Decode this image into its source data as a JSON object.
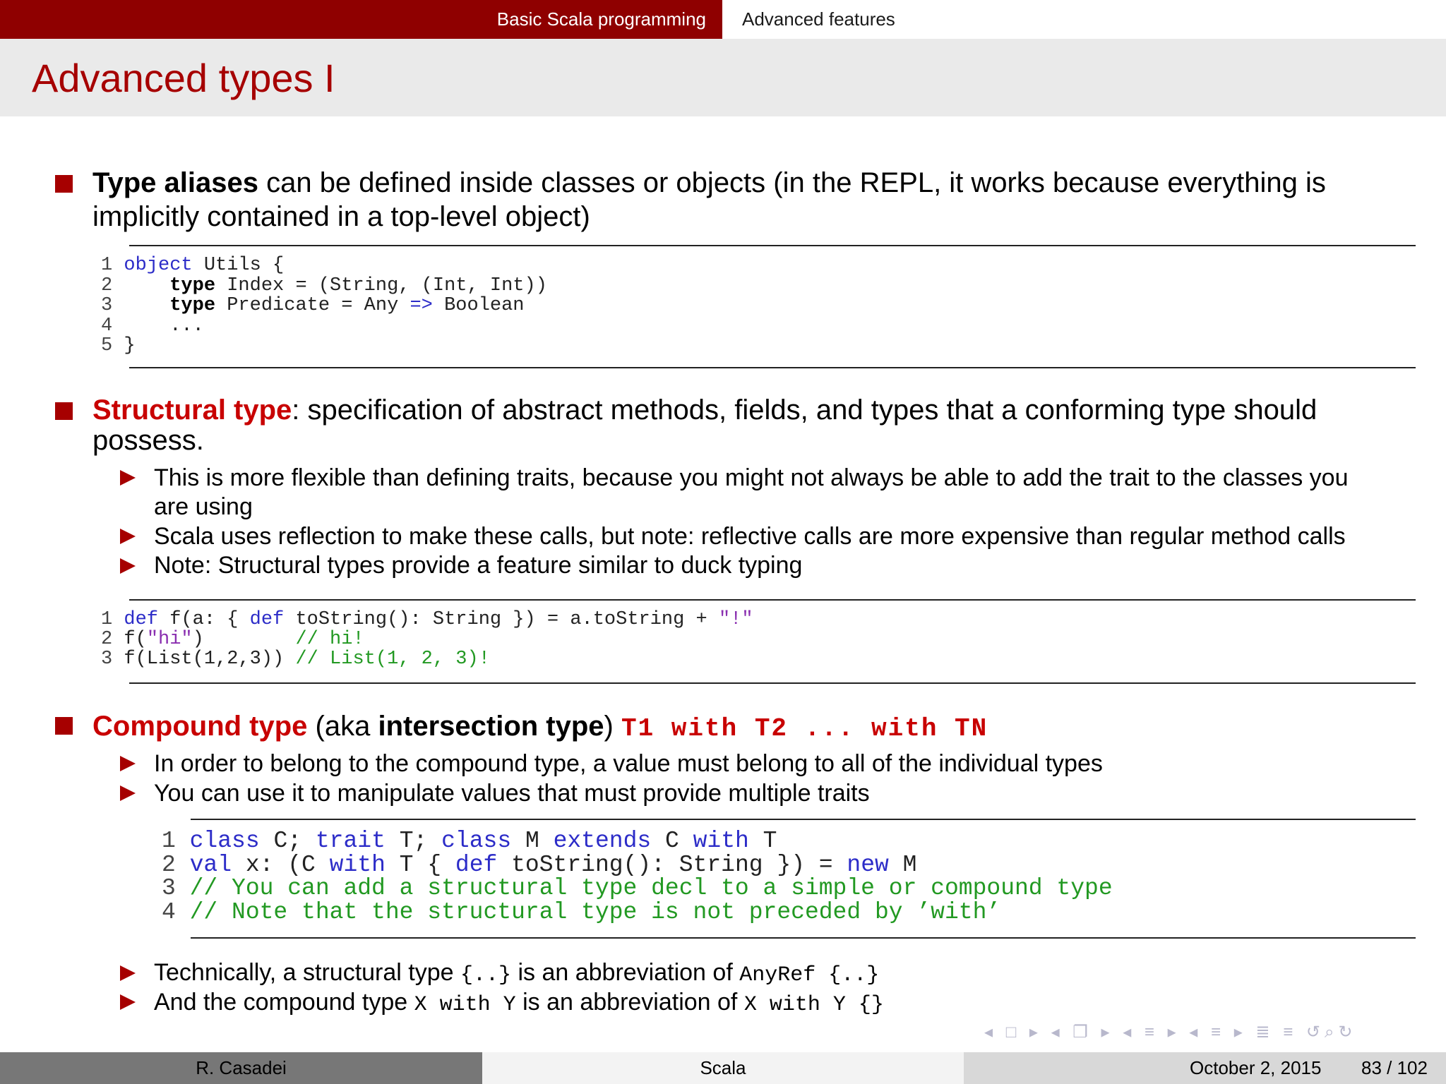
{
  "nav": {
    "section_basic": "Basic Scala programming",
    "section_advanced": "Advanced features"
  },
  "frame": {
    "title": "Advanced types I"
  },
  "type_aliases": {
    "term": "Type aliases",
    "line1": " can be defined inside classes or objects (in the REPL, it works because everything is",
    "line2": "implicitly contained in a top-level object)",
    "code": [
      {
        "n": "1",
        "parts": [
          [
            "kw",
            "object"
          ],
          [
            "p",
            " Utils {"
          ]
        ]
      },
      {
        "n": "2",
        "parts": [
          [
            "p",
            "    "
          ],
          [
            "kb",
            "type"
          ],
          [
            "p",
            " Index = (String, (Int, Int))"
          ]
        ]
      },
      {
        "n": "3",
        "parts": [
          [
            "p",
            "    "
          ],
          [
            "kb",
            "type"
          ],
          [
            "p",
            " Predicate = Any "
          ],
          [
            "op",
            "=>"
          ],
          [
            "p",
            " Boolean"
          ]
        ]
      },
      {
        "n": "4",
        "parts": [
          [
            "p",
            "    ..."
          ]
        ]
      },
      {
        "n": "5",
        "parts": [
          [
            "p",
            "}"
          ]
        ]
      }
    ]
  },
  "structural": {
    "term": "Structural type",
    "line1": ": specification of abstract methods, fields, and types that a conforming type should",
    "line2": "possess.",
    "subs": [
      {
        "l1": "This is more flexible than defining traits, because you might not always be able to add the trait to the classes you",
        "l2": "are using"
      },
      {
        "l1": "Scala uses reflection to make these calls, but note: reflective calls are more expensive than regular method calls",
        "l2": ""
      },
      {
        "l1": "Note: Structural types provide a feature similar to duck typing",
        "l2": ""
      }
    ],
    "code": [
      {
        "n": "1",
        "parts": [
          [
            "kw",
            "def"
          ],
          [
            "p",
            " f(a: { "
          ],
          [
            "kw",
            "def"
          ],
          [
            "p",
            " toString(): String }) = a.toString + "
          ],
          [
            "str",
            "\"!\""
          ]
        ]
      },
      {
        "n": "2",
        "parts": [
          [
            "p",
            "f("
          ],
          [
            "str",
            "\"hi\""
          ],
          [
            "p",
            ")        "
          ],
          [
            "cm",
            "// hi!"
          ]
        ]
      },
      {
        "n": "3",
        "parts": [
          [
            "p",
            "f(List(1,2,3)) "
          ],
          [
            "cm",
            "// List(1, 2, 3)!"
          ]
        ]
      }
    ]
  },
  "compound": {
    "term": "Compound type",
    "aka_open": " (aka ",
    "aka_term": "intersection type",
    "aka_close": ") ",
    "syntax": "T1 with T2 ...  with TN",
    "subs": [
      "In order to belong to the compound type, a value must belong to all of the individual types",
      "You can use it to manipulate values that must provide multiple traits"
    ],
    "code": [
      {
        "n": "1",
        "parts": [
          [
            "kw",
            "class"
          ],
          [
            "p",
            " C; "
          ],
          [
            "kw",
            "trait"
          ],
          [
            "p",
            " T; "
          ],
          [
            "kw",
            "class"
          ],
          [
            "p",
            " M "
          ],
          [
            "kw",
            "extends"
          ],
          [
            "p",
            " C "
          ],
          [
            "kw",
            "with"
          ],
          [
            "p",
            " T"
          ]
        ]
      },
      {
        "n": "2",
        "parts": [
          [
            "kw",
            "val"
          ],
          [
            "p",
            " x: (C "
          ],
          [
            "kw",
            "with"
          ],
          [
            "p",
            " T { "
          ],
          [
            "kw",
            "def"
          ],
          [
            "p",
            " toString(): String }) = "
          ],
          [
            "kw",
            "new"
          ],
          [
            "p",
            " M"
          ]
        ]
      },
      {
        "n": "3",
        "parts": [
          [
            "cm",
            "// You can add a structural type decl to a simple or compound type"
          ]
        ]
      },
      {
        "n": "4",
        "parts": [
          [
            "cm",
            "// Note that the structural type is not preceded by ’with’"
          ]
        ]
      }
    ],
    "tech1_a": "Technically, a structural type ",
    "tech1_code1": "{..}",
    "tech1_b": " is an abbreviation of ",
    "tech1_code2": "AnyRef {..}",
    "tech2_a": "And the compound type ",
    "tech2_code1": "X with Y",
    "tech2_b": " is an abbreviation of ",
    "tech2_code2": "X with Y {}"
  },
  "navsymbols": "◂ □ ▸ ◂ ❐ ▸ ◂ ≡ ▸ ◂ ≡ ▸ ≣ ≡ ↺⌕↻",
  "footer": {
    "author": "R. Casadei",
    "title": "Scala",
    "date": "October 2, 2015",
    "page": "83 / 102"
  }
}
